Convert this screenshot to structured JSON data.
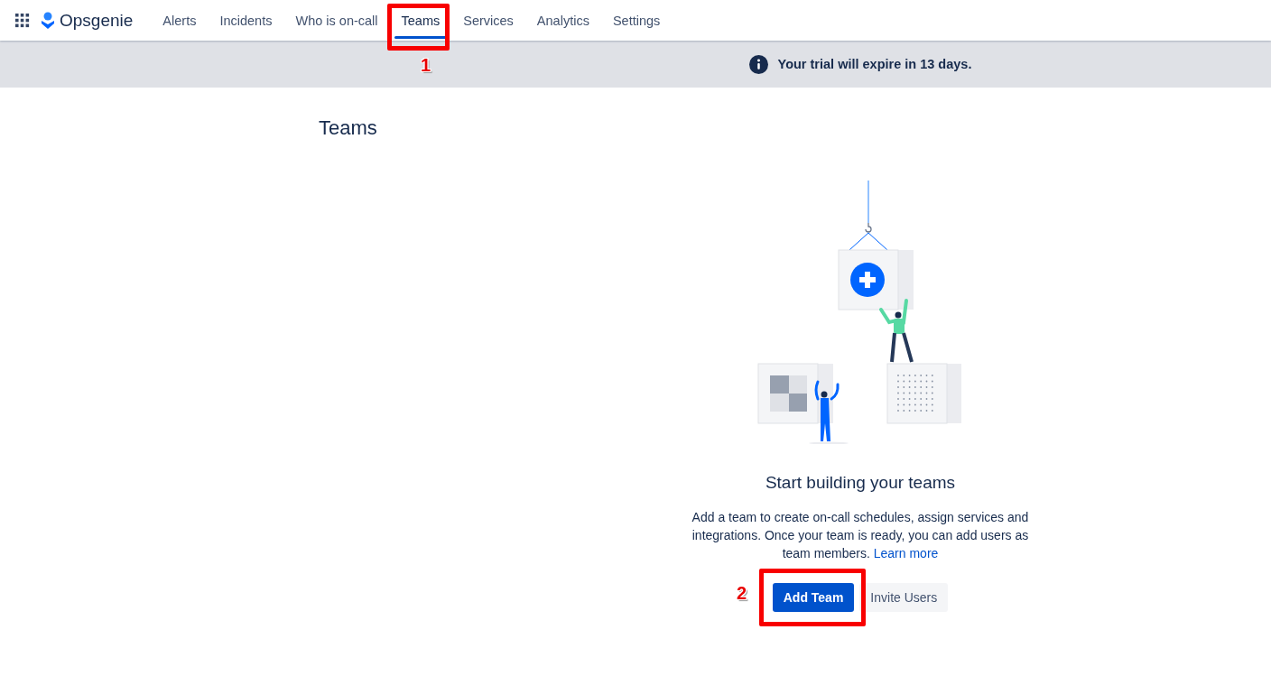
{
  "app": {
    "name": "Opsgenie"
  },
  "nav": [
    {
      "label": "Alerts",
      "selected": false
    },
    {
      "label": "Incidents",
      "selected": false
    },
    {
      "label": "Who is on-call",
      "selected": false
    },
    {
      "label": "Teams",
      "selected": true
    },
    {
      "label": "Services",
      "selected": false
    },
    {
      "label": "Analytics",
      "selected": false
    },
    {
      "label": "Settings",
      "selected": false
    }
  ],
  "banner": {
    "text": "Your trial will expire in 13 days."
  },
  "page": {
    "title": "Teams"
  },
  "empty_state": {
    "title": "Start building your teams",
    "description": "Add a team to create on-call schedules, assign services and integrations. Once your team is ready, you can add users as team members.",
    "link": "Learn more",
    "buttons": [
      {
        "label": "Add Team",
        "kind": "primary"
      },
      {
        "label": "Invite Users",
        "kind": "subtle"
      }
    ]
  },
  "annotations": [
    {
      "label": "1"
    },
    {
      "label": "2"
    }
  ]
}
